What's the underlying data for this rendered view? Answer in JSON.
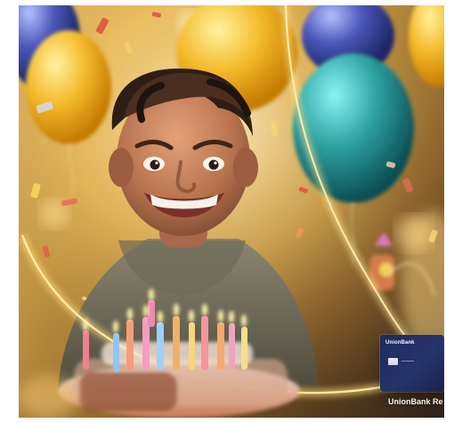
{
  "image": {
    "subject": "smiling boy at birthday party",
    "palette": {
      "background_warm": "#c79a44",
      "glow_gold": "#ffd66f",
      "balloon_yellow": "#f3b62c",
      "balloon_teal": "#2ea1a1",
      "balloon_blue": "#4b56b8",
      "shirt_gray": "#6f6b58",
      "skin": "#b8744f",
      "hair": "#2f1d15",
      "card_navy": "#1d2a58"
    }
  },
  "card": {
    "brand": "UnionBank"
  },
  "caption": {
    "text": "UnionBank Re"
  }
}
